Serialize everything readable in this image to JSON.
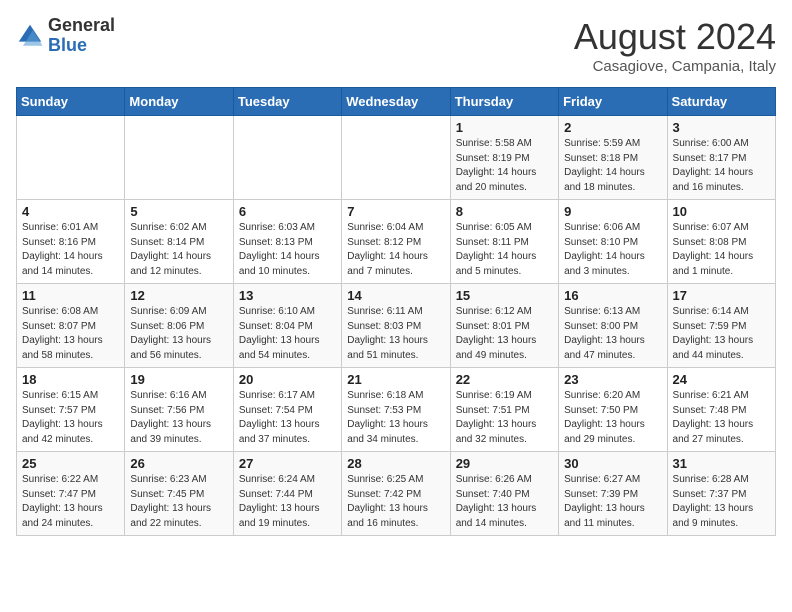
{
  "logo": {
    "general": "General",
    "blue": "Blue"
  },
  "header": {
    "title": "August 2024",
    "subtitle": "Casagiove, Campania, Italy"
  },
  "days_of_week": [
    "Sunday",
    "Monday",
    "Tuesday",
    "Wednesday",
    "Thursday",
    "Friday",
    "Saturday"
  ],
  "weeks": [
    [
      {
        "day": "",
        "info": ""
      },
      {
        "day": "",
        "info": ""
      },
      {
        "day": "",
        "info": ""
      },
      {
        "day": "",
        "info": ""
      },
      {
        "day": "1",
        "info": "Sunrise: 5:58 AM\nSunset: 8:19 PM\nDaylight: 14 hours\nand 20 minutes."
      },
      {
        "day": "2",
        "info": "Sunrise: 5:59 AM\nSunset: 8:18 PM\nDaylight: 14 hours\nand 18 minutes."
      },
      {
        "day": "3",
        "info": "Sunrise: 6:00 AM\nSunset: 8:17 PM\nDaylight: 14 hours\nand 16 minutes."
      }
    ],
    [
      {
        "day": "4",
        "info": "Sunrise: 6:01 AM\nSunset: 8:16 PM\nDaylight: 14 hours\nand 14 minutes."
      },
      {
        "day": "5",
        "info": "Sunrise: 6:02 AM\nSunset: 8:14 PM\nDaylight: 14 hours\nand 12 minutes."
      },
      {
        "day": "6",
        "info": "Sunrise: 6:03 AM\nSunset: 8:13 PM\nDaylight: 14 hours\nand 10 minutes."
      },
      {
        "day": "7",
        "info": "Sunrise: 6:04 AM\nSunset: 8:12 PM\nDaylight: 14 hours\nand 7 minutes."
      },
      {
        "day": "8",
        "info": "Sunrise: 6:05 AM\nSunset: 8:11 PM\nDaylight: 14 hours\nand 5 minutes."
      },
      {
        "day": "9",
        "info": "Sunrise: 6:06 AM\nSunset: 8:10 PM\nDaylight: 14 hours\nand 3 minutes."
      },
      {
        "day": "10",
        "info": "Sunrise: 6:07 AM\nSunset: 8:08 PM\nDaylight: 14 hours\nand 1 minute."
      }
    ],
    [
      {
        "day": "11",
        "info": "Sunrise: 6:08 AM\nSunset: 8:07 PM\nDaylight: 13 hours\nand 58 minutes."
      },
      {
        "day": "12",
        "info": "Sunrise: 6:09 AM\nSunset: 8:06 PM\nDaylight: 13 hours\nand 56 minutes."
      },
      {
        "day": "13",
        "info": "Sunrise: 6:10 AM\nSunset: 8:04 PM\nDaylight: 13 hours\nand 54 minutes."
      },
      {
        "day": "14",
        "info": "Sunrise: 6:11 AM\nSunset: 8:03 PM\nDaylight: 13 hours\nand 51 minutes."
      },
      {
        "day": "15",
        "info": "Sunrise: 6:12 AM\nSunset: 8:01 PM\nDaylight: 13 hours\nand 49 minutes."
      },
      {
        "day": "16",
        "info": "Sunrise: 6:13 AM\nSunset: 8:00 PM\nDaylight: 13 hours\nand 47 minutes."
      },
      {
        "day": "17",
        "info": "Sunrise: 6:14 AM\nSunset: 7:59 PM\nDaylight: 13 hours\nand 44 minutes."
      }
    ],
    [
      {
        "day": "18",
        "info": "Sunrise: 6:15 AM\nSunset: 7:57 PM\nDaylight: 13 hours\nand 42 minutes."
      },
      {
        "day": "19",
        "info": "Sunrise: 6:16 AM\nSunset: 7:56 PM\nDaylight: 13 hours\nand 39 minutes."
      },
      {
        "day": "20",
        "info": "Sunrise: 6:17 AM\nSunset: 7:54 PM\nDaylight: 13 hours\nand 37 minutes."
      },
      {
        "day": "21",
        "info": "Sunrise: 6:18 AM\nSunset: 7:53 PM\nDaylight: 13 hours\nand 34 minutes."
      },
      {
        "day": "22",
        "info": "Sunrise: 6:19 AM\nSunset: 7:51 PM\nDaylight: 13 hours\nand 32 minutes."
      },
      {
        "day": "23",
        "info": "Sunrise: 6:20 AM\nSunset: 7:50 PM\nDaylight: 13 hours\nand 29 minutes."
      },
      {
        "day": "24",
        "info": "Sunrise: 6:21 AM\nSunset: 7:48 PM\nDaylight: 13 hours\nand 27 minutes."
      }
    ],
    [
      {
        "day": "25",
        "info": "Sunrise: 6:22 AM\nSunset: 7:47 PM\nDaylight: 13 hours\nand 24 minutes."
      },
      {
        "day": "26",
        "info": "Sunrise: 6:23 AM\nSunset: 7:45 PM\nDaylight: 13 hours\nand 22 minutes."
      },
      {
        "day": "27",
        "info": "Sunrise: 6:24 AM\nSunset: 7:44 PM\nDaylight: 13 hours\nand 19 minutes."
      },
      {
        "day": "28",
        "info": "Sunrise: 6:25 AM\nSunset: 7:42 PM\nDaylight: 13 hours\nand 16 minutes."
      },
      {
        "day": "29",
        "info": "Sunrise: 6:26 AM\nSunset: 7:40 PM\nDaylight: 13 hours\nand 14 minutes."
      },
      {
        "day": "30",
        "info": "Sunrise: 6:27 AM\nSunset: 7:39 PM\nDaylight: 13 hours\nand 11 minutes."
      },
      {
        "day": "31",
        "info": "Sunrise: 6:28 AM\nSunset: 7:37 PM\nDaylight: 13 hours\nand 9 minutes."
      }
    ]
  ]
}
